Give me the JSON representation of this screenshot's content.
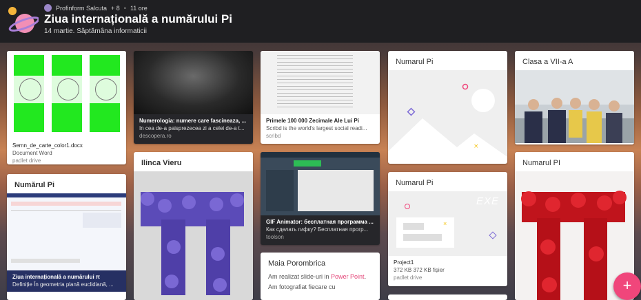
{
  "header": {
    "author": "Profinform Salcuta",
    "likes": "+ 8",
    "time": "11 ore",
    "title": "Ziua internațională a numărului Pi",
    "subtitle": "14 martie. Săptămâna informaticii"
  },
  "cards": {
    "c1": {
      "title": "Semn_de_carte_color1.docx",
      "desc": "Document Word",
      "source": "padlet drive"
    },
    "c2": {
      "title": "Numerologia: numere care fascineaza, ...",
      "desc": "In cea de-a paisprezecea zi a celei de-a t...",
      "source": "descopera.ro"
    },
    "c3": {
      "title": "Primele 100 000 Zecimale Ale Lui Pi",
      "desc": "Scribd is the world's largest social readi...",
      "source": "scribd"
    },
    "c4": {
      "heading": "Numarul Pi"
    },
    "c5": {
      "heading": "Clasa a VII-a A"
    },
    "c6": {
      "heading": "Numărul Pi",
      "title": "Ziua internațională a numărului π",
      "desc": "Definiție În geometria plană euclidiană, ..."
    },
    "c7": {
      "heading": "Ilinca Vieru"
    },
    "c8": {
      "title": "GIF Animator: бесплатная программа ...",
      "desc": "Как сделать гифку? Бесплатная прогр...",
      "source": "toolson"
    },
    "c9": {
      "heading": "Numarul Pi",
      "exe": "EXE",
      "title": "Project1",
      "desc": "372 KB 372 KB fișier",
      "source": "padlet drive"
    },
    "c10": {
      "heading": "Numarul PI"
    },
    "c11": {
      "heading": "Maia Porombrica",
      "body1": "Am realizat slide-uri in ",
      "body_link": "Power Point",
      "body2": ". Am fotografiat fiecare cu"
    }
  },
  "fab": {
    "label": "+"
  },
  "colors": {
    "accent": "#f0467b",
    "header_bg": "#1f1f22",
    "green_doc": "#22e81f"
  }
}
